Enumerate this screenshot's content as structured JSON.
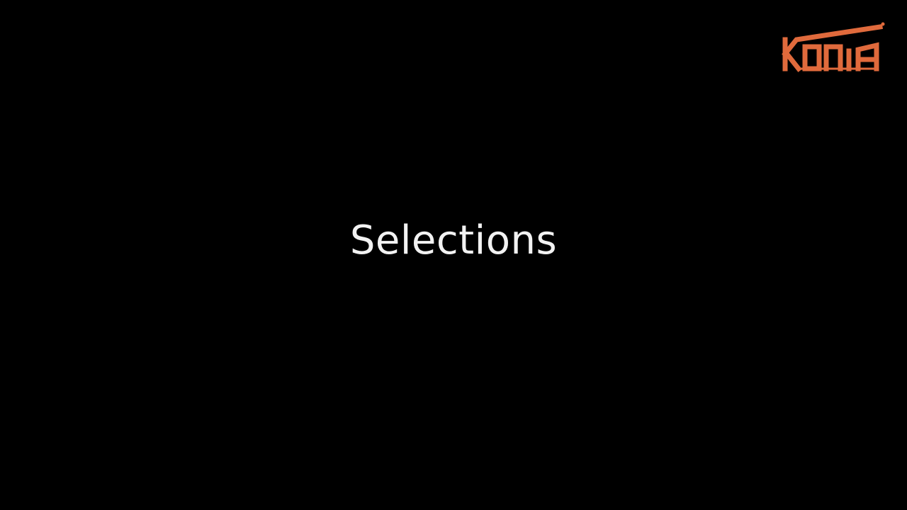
{
  "slide": {
    "title": "Selections",
    "background_color": "#000000",
    "title_color": "#f2f2f2"
  },
  "logo": {
    "text": "KONIA",
    "color": "#e06a3c",
    "icon": "konia-logo"
  }
}
